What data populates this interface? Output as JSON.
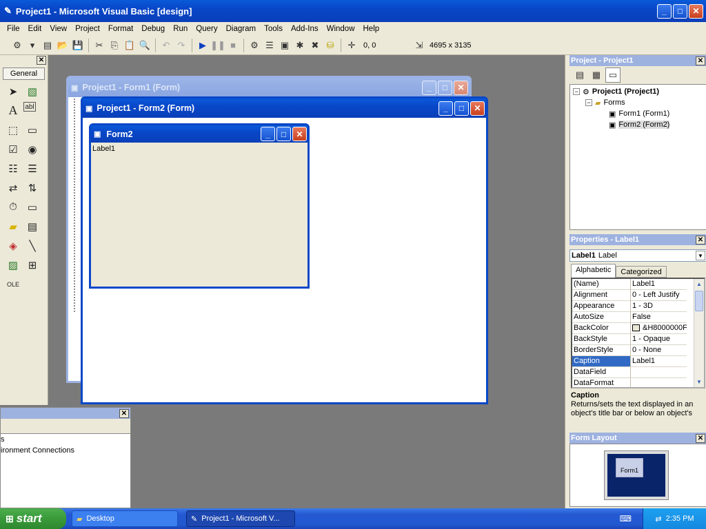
{
  "main_window": {
    "title": "Project1 - Microsoft Visual Basic [design]"
  },
  "menu": [
    "File",
    "Edit",
    "View",
    "Project",
    "Format",
    "Debug",
    "Run",
    "Query",
    "Diagram",
    "Tools",
    "Add-Ins",
    "Window",
    "Help"
  ],
  "toolbar": {
    "position": "0, 0",
    "size": "4695 x 3135"
  },
  "toolbox": {
    "tab_label": "General"
  },
  "form1_window": {
    "title": "Project1 - Form1 (Form)"
  },
  "form2_window": {
    "title": "Project1 - Form2 (Form)"
  },
  "form2_design": {
    "caption": "Form2",
    "label_text": "Label1"
  },
  "project_explorer": {
    "title": "Project - Project1",
    "root": "Project1 (Project1)",
    "folder": "Forms",
    "items": [
      "Form1 (Form1)",
      "Form2 (Form2)"
    ]
  },
  "properties": {
    "title": "Properties - Label1",
    "object_name": "Label1",
    "object_type": "Label",
    "tabs": [
      "Alphabetic",
      "Categorized"
    ],
    "rows": [
      {
        "name": "(Name)",
        "value": "Label1"
      },
      {
        "name": "Alignment",
        "value": "0 - Left Justify"
      },
      {
        "name": "Appearance",
        "value": "1 - 3D"
      },
      {
        "name": "AutoSize",
        "value": "False"
      },
      {
        "name": "BackColor",
        "value": "&H8000000F"
      },
      {
        "name": "BackStyle",
        "value": "1 - Opaque"
      },
      {
        "name": "BorderStyle",
        "value": "0 - None"
      },
      {
        "name": "Caption",
        "value": "Label1"
      },
      {
        "name": "DataField",
        "value": ""
      },
      {
        "name": "DataFormat",
        "value": ""
      }
    ],
    "desc_title": "Caption",
    "desc_text": "Returns/sets the text displayed in an object's title bar or below an object's"
  },
  "form_layout": {
    "title": "Form Layout",
    "thumb_label": "Form1"
  },
  "immediate_panel": {
    "line1": "s",
    "line2": "ironment Connections"
  },
  "taskbar": {
    "start_label": "start",
    "tasks": [
      "Desktop",
      "Project1 - Microsoft V..."
    ],
    "clock": "2:35 PM"
  }
}
